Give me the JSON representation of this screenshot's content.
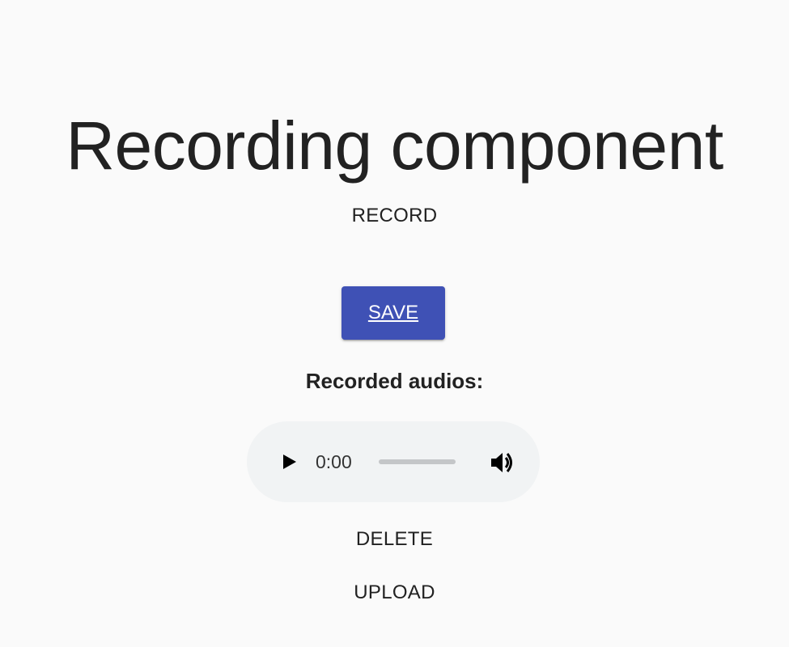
{
  "page": {
    "title": "Recording component"
  },
  "controls": {
    "record_label": "RECORD",
    "save_label": "SAVE",
    "delete_label": "DELETE",
    "upload_label": "UPLOAD"
  },
  "recordings": {
    "heading": "Recorded audios:",
    "items": [
      {
        "current_time": "0:00",
        "progress": 0,
        "icons": [
          "play-icon",
          "volume-icon"
        ]
      }
    ]
  },
  "colors": {
    "background": "#fafafa",
    "primary": "#3f51b5",
    "player_background": "#f1f3f4",
    "text": "#212121"
  }
}
